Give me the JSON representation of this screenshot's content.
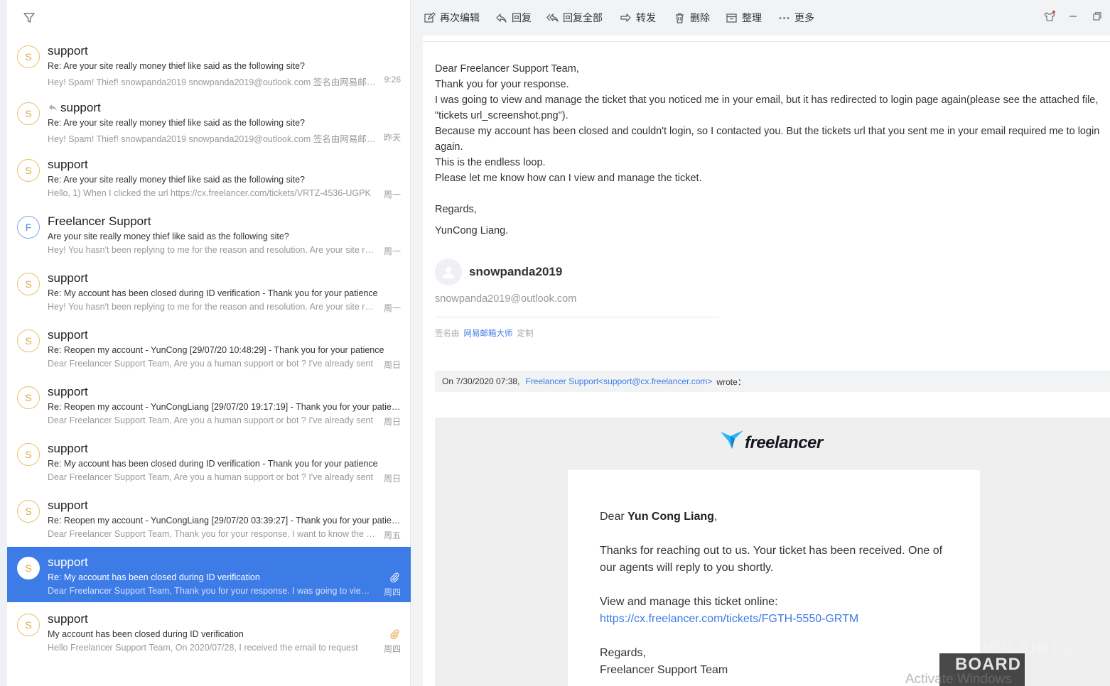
{
  "mail_list": {
    "items": [
      {
        "avatar": "S",
        "sender": "support",
        "subject": "Re:   Are your site really money thief like said as the following site?",
        "preview": "Hey! Spam! Thief! snowpanda2019 snowpanda2019@outlook.com 签名由网易邮箱大师定制",
        "time": "9:26"
      },
      {
        "avatar": "S",
        "sender": "support",
        "subject": "Re:  Are your site really money thief like said as the following site?",
        "preview": "Hey! Spam! Thief! snowpanda2019 snowpanda2019@outlook.com 签名由网易邮箱大师定制",
        "time": "昨天"
      },
      {
        "avatar": "S",
        "sender": "support",
        "subject": "Re:  Are your site really money thief like said as the following site?",
        "preview": "Hello, 1) When I clicked the url https://cx.freelancer.com/tickets/VRTZ-4536-UGPK",
        "time": "周一"
      },
      {
        "avatar": "F",
        "sender": "Freelancer Support",
        "subject": "Are your site really money thief like said as the following site?",
        "preview": "Hey! You hasn't been replying to me for the reason and resolution. Are your site really",
        "time": "周一"
      },
      {
        "avatar": "S",
        "sender": "support",
        "subject": "Re:  My account has been closed during ID verification - Thank you for your patience",
        "preview": "Hey! You hasn't been replying to me for the reason and resolution. Are your site really",
        "time": "周一"
      },
      {
        "avatar": "S",
        "sender": "support",
        "subject": "Re:  Reopen my account - YunCong [29/07/20 10:48:29] - Thank you for your patience",
        "preview": "Dear Freelancer Support Team, Are you a human support or bot ? I've already sent",
        "time": "周日"
      },
      {
        "avatar": "S",
        "sender": "support",
        "subject": "Re:  Reopen my account - YunCongLiang [29/07/20 19:17:19] - Thank you for your patience",
        "preview": "Dear Freelancer Support Team, Are you a human support or bot ? I've already sent",
        "time": "周日"
      },
      {
        "avatar": "S",
        "sender": "support",
        "subject": "Re:  My account has been closed during ID verification - Thank you for your patience",
        "preview": "Dear Freelancer Support Team, Are you a human support or bot ? I've already sent",
        "time": "周日"
      },
      {
        "avatar": "S",
        "sender": "support",
        "subject": "Re:  Reopen my account - YunCongLiang [29/07/20 03:39:27] - Thank you for your patience",
        "preview": "Dear Freelancer Support Team, Thank you for your response. I want to know the reason",
        "time": "周五"
      },
      {
        "avatar": "S",
        "sender": "support",
        "subject": "Re: My account has been closed during ID verification",
        "preview": "Dear Freelancer Support Team, Thank you for your response. I was going to view and",
        "time": "周四"
      },
      {
        "avatar": "S",
        "sender": "support",
        "subject": "My account has been closed during ID verification",
        "preview": "Hello Freelancer Support Team, On 2020/07/28, I received the email to request",
        "time": "周四"
      }
    ]
  },
  "toolbar": {
    "reedit": "再次编辑",
    "reply": "回复",
    "reply_all": "回复全部",
    "forward": "转发",
    "delete": "删除",
    "organize": "整理",
    "more": "更多"
  },
  "message": {
    "greeting": "Dear Freelancer Support Team,",
    "line1": "Thank you for your response.",
    "line2": "I was going to view and manage the ticket that you noticed me in your email, but it has redirected to login page again(please see the attached file, \"tickets url_screenshot.png\").",
    "line3": "Because my account has been closed and couldn't login, so I contacted you. But the tickets url that you sent me in your email required me to login again.",
    "line4": "This is the endless loop.",
    "line5": "Please let me know how can I view and manage the ticket.",
    "regards": "Regards,",
    "name": "YunCong Liang."
  },
  "signature": {
    "name": "snowpanda2019",
    "email": "snowpanda2019@outlook.com",
    "credit_prefix": "签名由",
    "credit_link": "网易邮箱大师",
    "credit_suffix": "定制"
  },
  "quote": {
    "prefix": "On 7/30/2020 07:38,",
    "sender_link": "Freelancer Support<support@cx.freelancer.com>",
    "suffix": "wrote："
  },
  "quoted_mail": {
    "logo_text": "freelancer",
    "dear": "Dear ",
    "customer": "Yun Cong Liang",
    "comma": ",",
    "para1": "Thanks for reaching out to us. Your ticket has been received. One of our agents will reply to you shortly.",
    "para2": "View and manage this ticket online:",
    "ticket_link": "https://cx.freelancer.com/tickets/FGTH-5550-GRTM",
    "regards": "Regards,",
    "team": "Freelancer Support Team"
  },
  "overlay": {
    "watermark_top": "COMPLAINTS",
    "watermark_bottom": "BOARD",
    "activate": "Activate Windows"
  },
  "colors": {
    "selected": "#3d7be6",
    "link": "#3d7be6",
    "avatar_ring": "#e8c26a"
  }
}
